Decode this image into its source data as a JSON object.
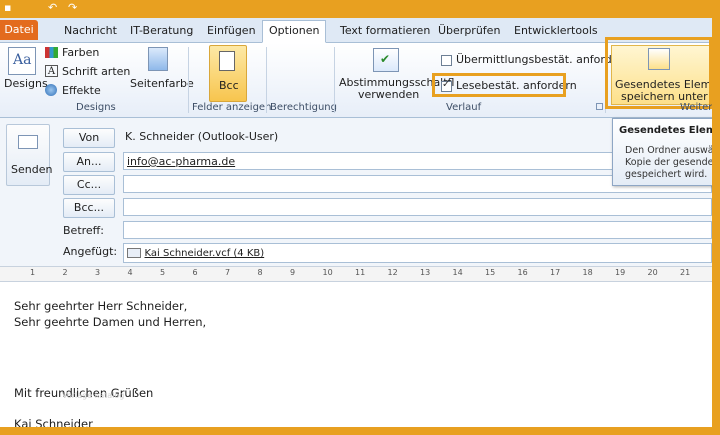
{
  "tabs": [
    "Datei",
    "Nachricht",
    "IT-Beratung",
    "Einfügen",
    "Optionen",
    "Text formatieren",
    "Überprüfen",
    "Entwicklertools"
  ],
  "active_tab": "Optionen",
  "ribbon": {
    "designs_label": "Designs",
    "farben": "Farben",
    "schriftarten": "Schrift arten",
    "effekte": "Effekte",
    "seitenfarbe": "Seitenfarbe",
    "designs_group": "Designs",
    "bcc": "Bcc",
    "felder_anzeigen": "Felder anzeigen",
    "berechtigung": "Berechtigung",
    "abstimmung_l1": "Abstimmungsschaltfl",
    "abstimmung_l2": "verwenden",
    "uebermittlung": "Übermittlungsbestät. anfordern",
    "lesebestaet": "Lesebestät. anfordern",
    "verlauf": "Verlauf",
    "gesendetes_l1": "Gesendetes Element",
    "gesendetes_l2": "speichern unter",
    "weitere": "Weitere"
  },
  "tooltip": {
    "title": "Gesendetes Element",
    "desc": "Den Ordner auswä\nKopie der gesendet\ngespeichert wird."
  },
  "header": {
    "senden": "Senden",
    "von_btn": "Von",
    "von_value": "K. Schneider (Outlook-User)",
    "an_btn": "An...",
    "an_value": "info@ac-pharma.de",
    "cc_btn": "Cc...",
    "bcc_btn": "Bcc...",
    "betreff_label": "Betreff:",
    "angefuegt_label": "Angefügt:",
    "attachment": "Kai Schneider.vcf (4 KB)"
  },
  "ruler_ticks": [
    "1",
    "2",
    "3",
    "4",
    "5",
    "6",
    "7",
    "8",
    "9",
    "10",
    "11",
    "12",
    "13",
    "14",
    "15",
    "16",
    "17",
    "18",
    "19",
    "20",
    "21"
  ],
  "body": {
    "line1": "Sehr geehrter Herr Schneider,",
    "line2": "Sehr geehrte Damen und Herren,",
    "closing": "Mit freundlichen Grüßen",
    "signature": "Kai Schneider",
    "watermark": "Vorlage katalog"
  },
  "colors": {
    "accent": "#e8a020",
    "file_tab": "#e36b1e",
    "ribbon_border": "#a9bfd6"
  }
}
